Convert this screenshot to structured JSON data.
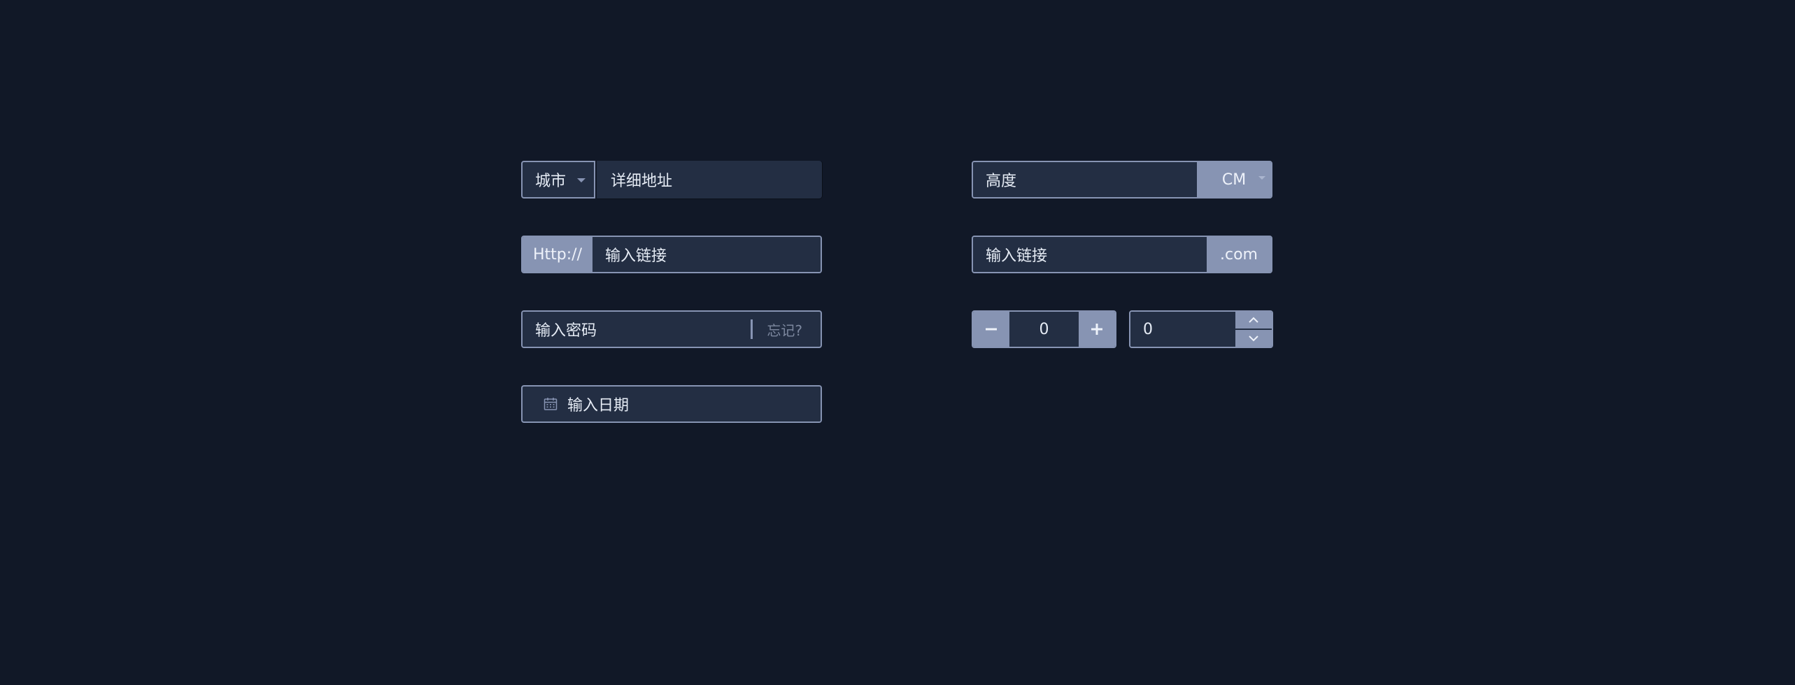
{
  "address_group": {
    "city_label": "城市",
    "address_placeholder": "详细地址"
  },
  "url_group": {
    "prefix": "Http://",
    "placeholder": "输入链接"
  },
  "password_group": {
    "placeholder": "输入密码",
    "forgot_label": "忘记?"
  },
  "date_group": {
    "placeholder": "输入日期",
    "icon": "calendar-icon"
  },
  "height_group": {
    "placeholder": "高度",
    "unit": "CM"
  },
  "domain_group": {
    "placeholder": "输入链接",
    "suffix": ".com"
  },
  "stepper_horizontal": {
    "value": "0",
    "minus_icon": "minus-icon",
    "plus_icon": "plus-icon"
  },
  "stepper_vertical": {
    "value": "0",
    "up_icon": "chevron-up-icon",
    "down_icon": "chevron-down-icon"
  },
  "colors": {
    "background": "#111827",
    "field": "#232e43",
    "accent": "#8794b3",
    "text": "#e6ecf5"
  }
}
